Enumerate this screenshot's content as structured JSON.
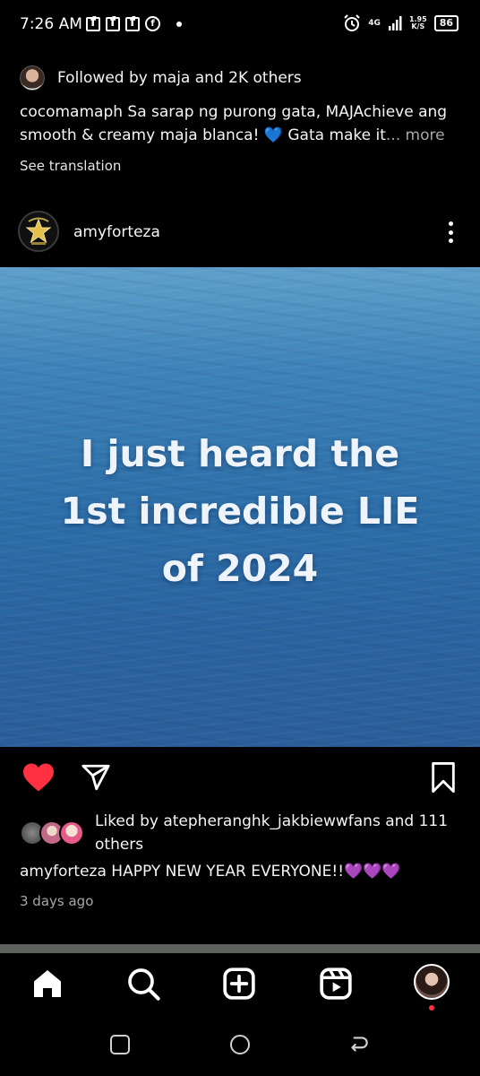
{
  "status_bar": {
    "time": "7:26 AM",
    "net_type": "4G",
    "net_speed_value": "1.95",
    "net_speed_unit": "K/S",
    "battery": "86",
    "icons": [
      "facebook-icon",
      "facebook-icon",
      "facebook-icon",
      "facebook-circle-icon",
      "notification-dot-icon",
      "alarm-icon",
      "signal-icon",
      "battery-icon"
    ]
  },
  "previous_post": {
    "followed_by": "Followed by maja and 2K others",
    "caption_text": "cocomamaph Sa sarap ng purong gata, MAJAchieve ang smooth & creamy maja blanca! 💙 Gata make it",
    "caption_ellipsis": "...",
    "more_label": " more",
    "see_translation": "See translation"
  },
  "post": {
    "username": "amyforteza",
    "image_text_lines": [
      "I just heard the",
      "1st incredible LIE",
      "of 2024"
    ],
    "image_colors": {
      "sea_top": "#5fa0cb",
      "sea_bottom": "#2b5e99"
    },
    "liked": true,
    "liked_by": "Liked by atepheranghk_jakbiewwfans and 111 others",
    "caption": "amyforteza HAPPY NEW YEAR EVERYONE!!💜💜💜",
    "timestamp": "3 days ago"
  },
  "bottom_nav": {
    "items": [
      "home-icon",
      "search-icon",
      "create-icon",
      "reels-icon",
      "profile-avatar"
    ],
    "active": "home-icon"
  },
  "system_nav": [
    "recent-apps-icon",
    "home-circle-icon",
    "back-icon"
  ],
  "colors": {
    "like_red": "#ff3040",
    "background": "#000000",
    "secondary_text": "#a8a8a8"
  }
}
